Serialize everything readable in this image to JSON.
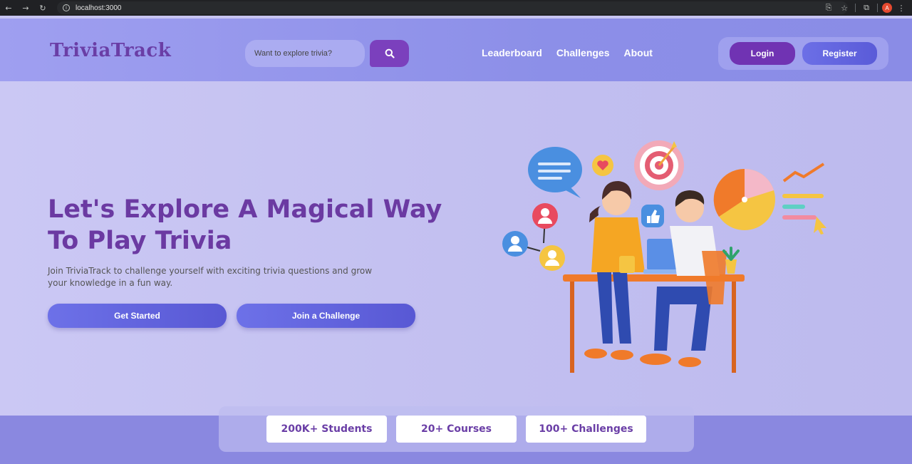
{
  "browser": {
    "url": "localhost:3000",
    "profile_initial": "A"
  },
  "header": {
    "logo": "TriviaTrack",
    "search_placeholder": "Want to explore trivia?",
    "nav": [
      "Leaderboard",
      "Challenges",
      "About"
    ],
    "login": "Login",
    "register": "Register"
  },
  "hero": {
    "title": "Let's Explore A Magical Way To Play Trivia",
    "subtitle": "Join TriviaTrack to challenge yourself with exciting trivia questions and grow your knowledge in a fun way.",
    "primary_button": "Get Started",
    "secondary_button": "Join a Challenge"
  },
  "stats": [
    "200K+ Students",
    "20+ Courses",
    "100+ Challenges"
  ],
  "colors": {
    "brand_purple": "#6b3aa2",
    "button_blue": "#5d5fd8",
    "header_bg": "#8c8fe8",
    "hero_bg": "#c7c4f2"
  }
}
